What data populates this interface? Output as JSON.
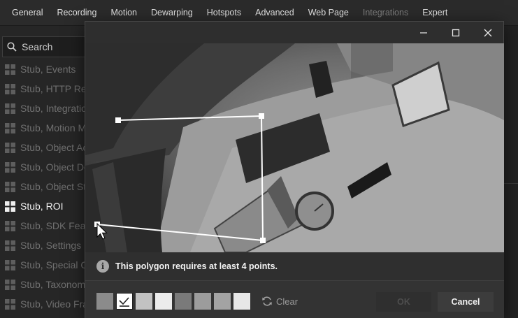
{
  "tabs": [
    {
      "label": "General",
      "state": "normal"
    },
    {
      "label": "Recording",
      "state": "normal"
    },
    {
      "label": "Motion",
      "state": "normal"
    },
    {
      "label": "Dewarping",
      "state": "normal"
    },
    {
      "label": "Hotspots",
      "state": "normal"
    },
    {
      "label": "Advanced",
      "state": "normal"
    },
    {
      "label": "Web Page",
      "state": "normal"
    },
    {
      "label": "Integrations",
      "state": "dimmed"
    },
    {
      "label": "Expert",
      "state": "normal"
    }
  ],
  "search": {
    "placeholder": "Search"
  },
  "plugins": [
    {
      "label": "Stub, Events"
    },
    {
      "label": "Stub, HTTP Requests"
    },
    {
      "label": "Stub, Integration Actions"
    },
    {
      "label": "Stub, Motion Metadata"
    },
    {
      "label": "Stub, Object Actions"
    },
    {
      "label": "Stub, Object Detection"
    },
    {
      "label": "Stub, Object Streamer"
    },
    {
      "label": "Stub, ROI"
    },
    {
      "label": "Stub, SDK Features"
    },
    {
      "label": "Stub, Settings"
    },
    {
      "label": "Stub, Special Objects"
    },
    {
      "label": "Stub, Taxonomy"
    },
    {
      "label": "Stub, Video Frames"
    }
  ],
  "active_plugin": "Stub, ROI",
  "dialog": {
    "message": "This polygon requires at least 4 points.",
    "clear_label": "Clear",
    "ok_label": "OK",
    "cancel_label": "Cancel",
    "selected_swatch": 1
  },
  "colors": {
    "swatches": [
      "#8b8b8b",
      "#f2f2f2",
      "#c2c2c2",
      "#ececec",
      "#7a7a7a",
      "#9c9c9c",
      "#a3a3a3",
      "#e7e7e7"
    ],
    "polygon": "#ffffff"
  },
  "icons": {
    "search": "search-icon",
    "plugin": "plugin-grid-icon",
    "minimize": "minimize-icon",
    "maximize": "maximize-icon",
    "close": "close-icon",
    "info": "info-icon",
    "clear": "refresh-icon",
    "cursor": "mouse-pointer-icon"
  }
}
